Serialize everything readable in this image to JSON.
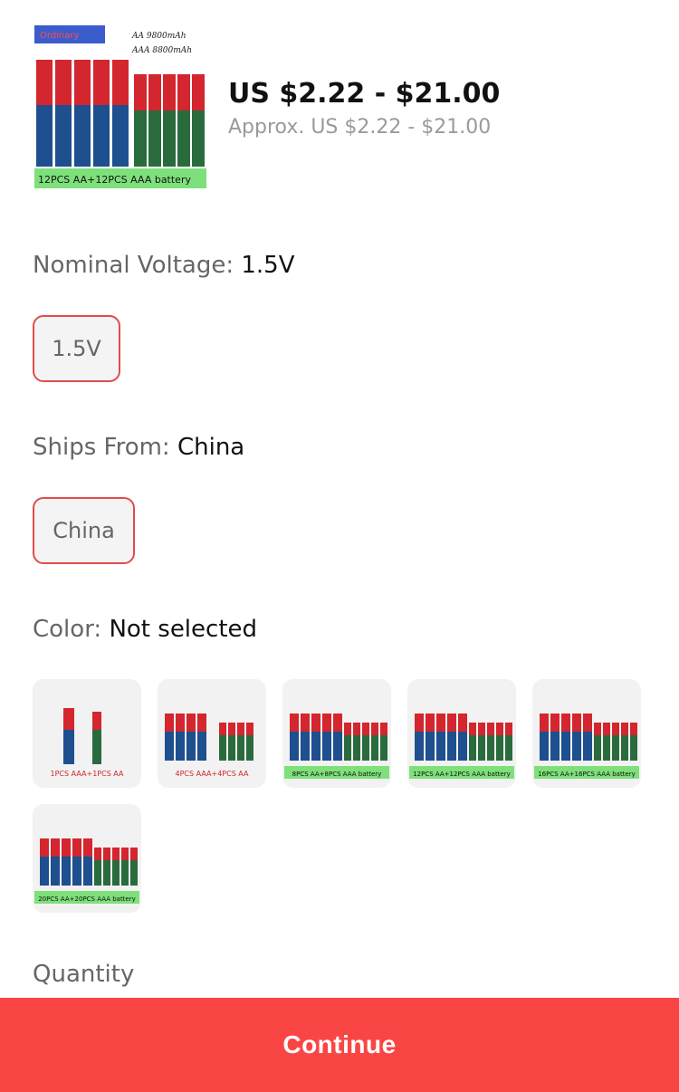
{
  "product": {
    "price": "US $2.22 - $21.00",
    "approx_price": "Approx. US $2.22 - $21.00",
    "thumb_caption": "12PCS AA+12PCS AAA battery",
    "thumb_note_1": "AA 9800mAh",
    "thumb_note_2": "AAA 8800mAh",
    "thumb_brand": "Ordinary"
  },
  "options": {
    "voltage": {
      "label": "Nominal Voltage: ",
      "value": "1.5V",
      "chip": "1.5V"
    },
    "ships_from": {
      "label": "Ships From: ",
      "value": "China",
      "chip": "China"
    },
    "color": {
      "label": "Color: ",
      "value": "Not selected",
      "swatches": [
        {
          "caption": "1PCS AAA+1PCS AA",
          "caption_color": "#d3262e"
        },
        {
          "caption": "4PCS AAA+4PCS AA",
          "caption_color": "#d3262e"
        },
        {
          "caption": "8PCS AA+8PCS AAA battery",
          "caption_color": "#111111"
        },
        {
          "caption": "12PCS AA+12PCS AAA battery",
          "caption_color": "#111111"
        },
        {
          "caption": "16PCS AA+16PCS AAA battery",
          "caption_color": "#111111"
        },
        {
          "caption": "20PCS AA+20PCS AAA battery",
          "caption_color": "#111111"
        }
      ]
    }
  },
  "quantity": {
    "label": "Quantity"
  },
  "footer": {
    "continue_label": "Continue"
  },
  "colors": {
    "accent": "#fa4545",
    "chip_border": "#e24b4b",
    "battery_red": "#d3262e",
    "battery_blue": "#1e4f8f",
    "battery_green": "#2a6b3e",
    "caption_green": "#7ee07a"
  }
}
